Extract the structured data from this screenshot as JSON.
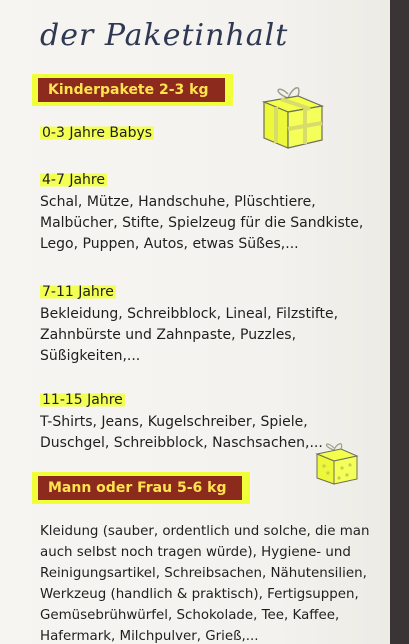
{
  "title": "der Paketinhalt",
  "kids": {
    "banner": "Kinderpakete 2-3 kg",
    "groups": [
      {
        "heading": "0-3 Jahre Babys",
        "lines": []
      },
      {
        "heading": "4-7 Jahre",
        "lines": [
          "Schal, Mütze, Handschuhe, Plüschtiere,",
          "Malbücher, Stifte, Spielzeug für die Sandkiste,",
          "Lego, Puppen, Autos, etwas Süßes,..."
        ]
      },
      {
        "heading": "7-11 Jahre",
        "lines": [
          "Bekleidung, Schreibblock, Lineal, Filzstifte,",
          "Zahnbürste und Zahnpaste, Puzzles,",
          "Süßigkeiten,..."
        ]
      },
      {
        "heading": "11-15 Jahre",
        "lines": [
          "T-Shirts, Jeans, Kugelschreiber, Spiele,",
          "Duschgel, Schreibblock, Naschsachen,..."
        ]
      }
    ]
  },
  "adult": {
    "banner": "Mann oder Frau 5-6 kg",
    "lines": [
      "Kleidung (sauber, ordentlich und solche, die man",
      "auch selbst noch tragen würde), Hygiene- und",
      "Reinigungsartikel, Schreibsachen, Nähutensilien,",
      "Werkzeug (handlich & praktisch), Fertigsuppen,",
      "Gemüsebrühwürfel, Schokolade, Tee, Kaffee,",
      "Hafermark, Milchpulver, Grieß,..."
    ]
  },
  "icons": {
    "gift_large": "gift-box-icon",
    "gift_small": "gift-box-icon"
  },
  "colors": {
    "banner_bg": "#8c2a1d",
    "banner_text": "#ffe44d",
    "highlight": "#f1ff3a",
    "title": "#2f3852"
  }
}
